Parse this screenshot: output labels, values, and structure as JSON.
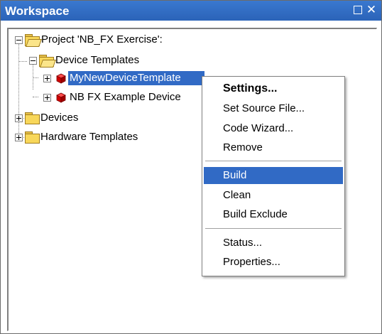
{
  "window": {
    "title": "Workspace"
  },
  "tree": {
    "project": "Project 'NB_FX Exercise':",
    "device_templates": "Device Templates",
    "item_selected": "MyNewDeviceTemplate",
    "item_example": "NB FX Example Device",
    "devices": "Devices",
    "hardware_templates": "Hardware Templates"
  },
  "context_menu": {
    "items": [
      {
        "label": "Settings...",
        "bold": true
      },
      {
        "label": "Set Source File..."
      },
      {
        "label": "Code Wizard..."
      },
      {
        "label": "Remove"
      },
      {
        "label": "Build",
        "highlighted": true
      },
      {
        "label": "Clean"
      },
      {
        "label": "Build Exclude"
      },
      {
        "label": "Status..."
      },
      {
        "label": "Properties..."
      }
    ]
  },
  "colors": {
    "titlebar": "#2b63b8",
    "selection": "#316ac5"
  }
}
